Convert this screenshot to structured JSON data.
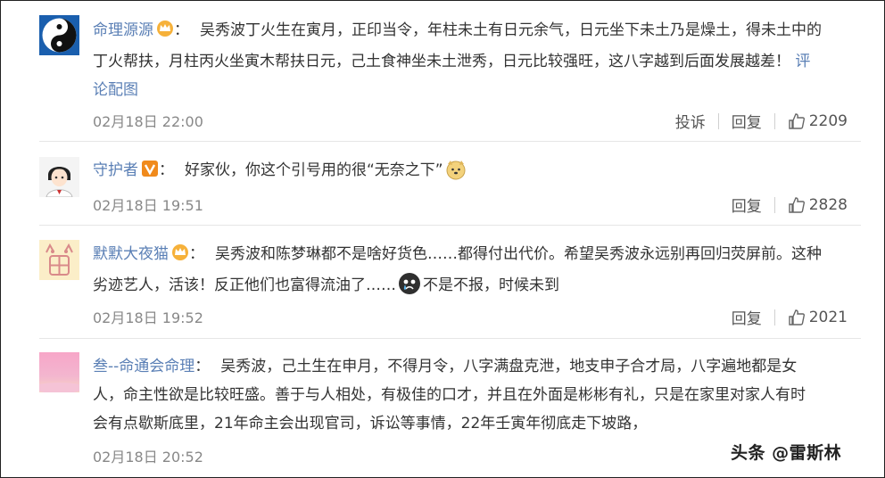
{
  "comments": [
    {
      "username": "命理源源",
      "badge": "crown-badge-icon",
      "line1": "吴秀波丁火生在寅月，正印当令，年柱未土有日元余气，日元坐下未土乃是燥土，得未土中的",
      "line2": "丁火帮扶，月柱丙火坐寅木帮扶日元，己土食神坐未土泄秀，日元比较强旺，这八字越到后面发展越差！",
      "line2_link": "评",
      "line3_link": "论配图",
      "time": "02月18日 22:00",
      "report_label": "投诉",
      "reply_label": "回复",
      "likes": "2209"
    },
    {
      "username": "守护者",
      "badge": "v-badge-icon",
      "line1": "好家伙，你这个引号用的很“无奈之下”",
      "emoji": "doge-emoji-icon",
      "time": "02月18日 19:51",
      "reply_label": "回复",
      "likes": "2828"
    },
    {
      "username": "默默大夜猫",
      "badge": "crown-badge-icon",
      "line1": "吴秀波和陈梦琳都不是啥好货色……都得付出代价。希望吴秀波永远别再回归荧屏前。这种",
      "line2a": "劣迹艺人，活该！反正他们也富得流油了……",
      "emoji": "crying-face-icon",
      "line2b": "不是不报，时候未到",
      "time": "02月18日 19:52",
      "reply_label": "回复",
      "likes": "2021"
    },
    {
      "username": "叁--命通会命理",
      "line1": "吴秀波，己土生在申月，不得月令，八字满盘克泄，地支申子合才局，八字遍地都是女",
      "line2": "人，命主性欲是比较旺盛。善于与人相处，有极佳的口才，并且在外面是彬彬有礼，只是在家里对家人有时",
      "line3": "会有点歇斯底里，21年命主会出现官司，诉讼等事情，22年壬寅年彻底走下坡路，",
      "time": "02月18日 20:52"
    }
  ],
  "watermark": "头条 @雷斯林",
  "colors": {
    "link": "#5a7fb5",
    "text": "#333333",
    "time": "#888888"
  }
}
